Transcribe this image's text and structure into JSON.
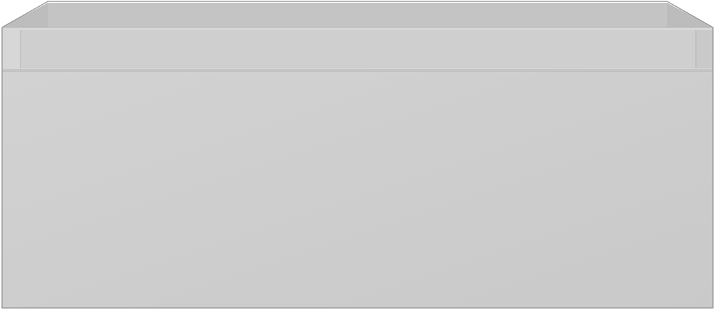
{
  "image": {
    "subject": "",
    "colors": {
      "background": "#ffffff",
      "front_panel": "#cfcfcf",
      "front_panel_light": "#d2d2d2",
      "side_panel": "#c9c9c9",
      "top_rim": "#d7d7d7",
      "inner_back": "#c4c4c4",
      "inner_wall_left": "#bdbdbd",
      "inner_wall_right": "#bcbcbc",
      "edge_line": "#b3b3b3",
      "outline": "#9a9a9a"
    }
  }
}
